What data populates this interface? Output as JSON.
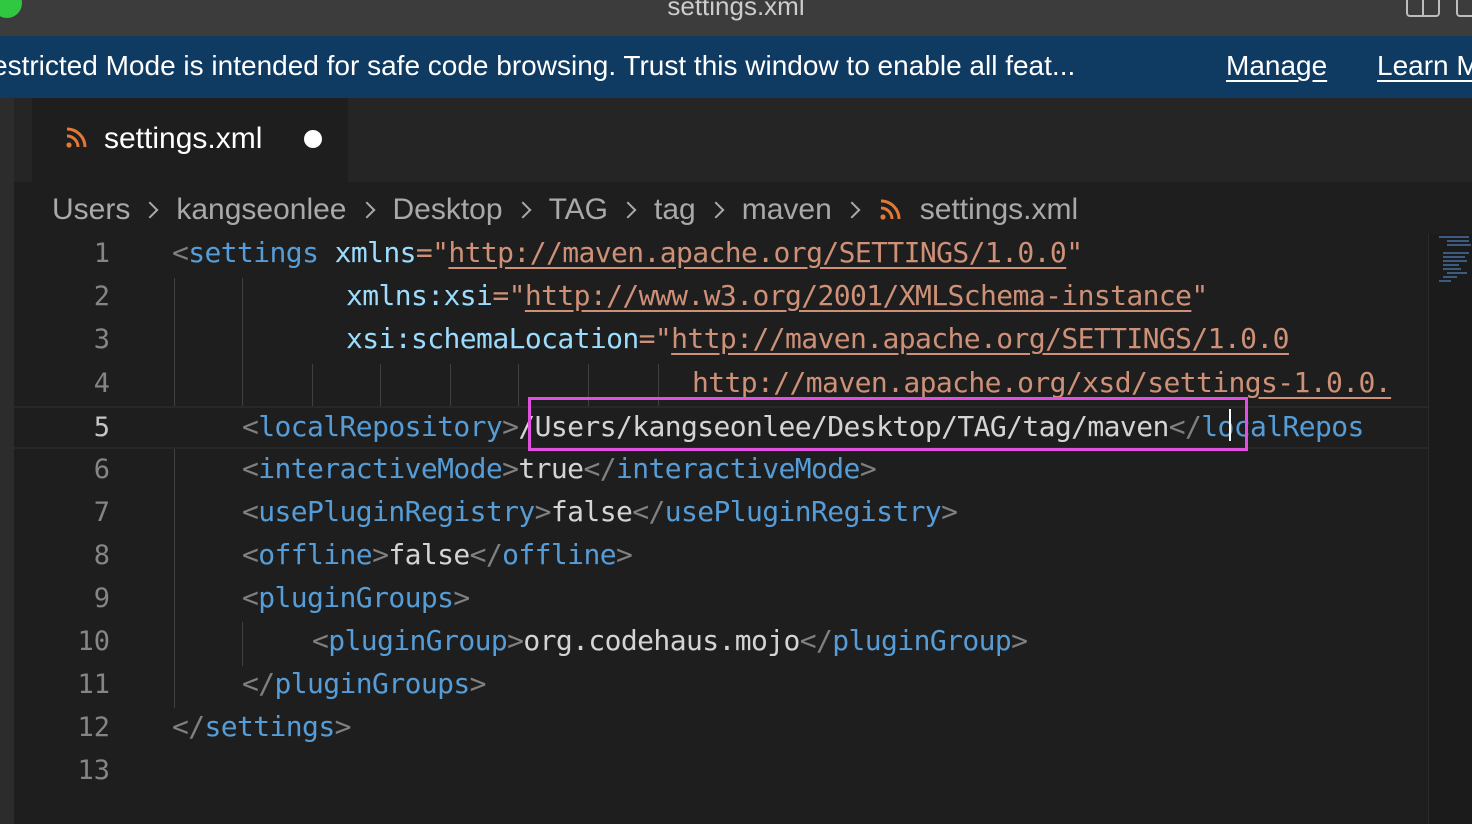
{
  "window": {
    "title": "settings.xml"
  },
  "banner": {
    "text": "estricted Mode is intended for safe code browsing. Trust this window to enable all feat...",
    "manage": "Manage",
    "learn": "Learn M"
  },
  "tab": {
    "label": "settings.xml",
    "icon": "rss-icon"
  },
  "breadcrumbs": [
    "Users",
    "kangseonlee",
    "Desktop",
    "TAG",
    "tag",
    "maven",
    "settings.xml"
  ],
  "editor": {
    "line_numbers": [
      "1",
      "2",
      "3",
      "4",
      "5",
      "6",
      "7",
      "8",
      "9",
      "10",
      "11",
      "12",
      "13"
    ],
    "active_line": "5",
    "lines": {
      "l1": {
        "open": "<",
        "tag": "settings",
        "attr": "xmlns",
        "eq": "=\"",
        "val": "http://maven.apache.org/SETTINGS/1.0.0",
        "close": "\""
      },
      "l2": {
        "attr": "xmlns:xsi",
        "eq": "=\"",
        "val": "http://www.w3.org/2001/XMLSchema-instance",
        "close": "\""
      },
      "l3": {
        "attr": "xsi:schemaLocation",
        "eq": "=\"",
        "val": "http://maven.apache.org/SETTINGS/1.0.0"
      },
      "l4": {
        "val": "http://maven.apache.org/xsd/settings-1.0.0."
      },
      "l5": {
        "lt": "<",
        "tag": "localRepository",
        "gt": ">",
        "text": "/Users/kangseonlee/Desktop/TAG/tag/maven",
        "end": "</",
        "endtag": "localRepos"
      },
      "l6": {
        "lt": "<",
        "tag": "interactiveMode",
        "gt": ">",
        "text": "true",
        "end": "</",
        "endtag": "interactiveMode",
        "gt2": ">"
      },
      "l7": {
        "lt": "<",
        "tag": "usePluginRegistry",
        "gt": ">",
        "text": "false",
        "end": "</",
        "endtag": "usePluginRegistry",
        "gt2": ">"
      },
      "l8": {
        "lt": "<",
        "tag": "offline",
        "gt": ">",
        "text": "false",
        "end": "</",
        "endtag": "offline",
        "gt2": ">"
      },
      "l9": {
        "lt": "<",
        "tag": "pluginGroups",
        "gt": ">"
      },
      "l10": {
        "lt": "<",
        "tag": "pluginGroup",
        "gt": ">",
        "text": "org.codehaus.mojo",
        "end": "</",
        "endtag": "pluginGroup",
        "gt2": ">"
      },
      "l11": {
        "end": "</",
        "endtag": "pluginGroups",
        "gt2": ">"
      },
      "l12": {
        "end": "</",
        "endtag": "settings",
        "gt2": ">"
      }
    }
  },
  "colors": {
    "banner_bg": "#0f3a62",
    "tag": "#569cd6",
    "attribute": "#9cdcfe",
    "string": "#ce9178",
    "highlight": "#e14fe0"
  }
}
